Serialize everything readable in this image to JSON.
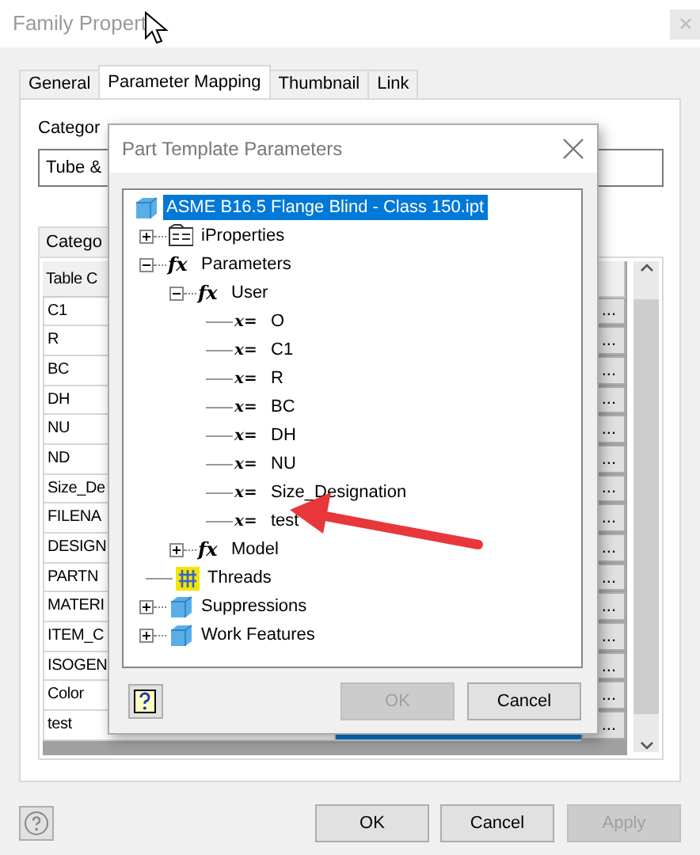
{
  "window": {
    "title": "Family Propert",
    "close_enabled": false
  },
  "tabs": [
    {
      "label": "General",
      "selected": false
    },
    {
      "label": "Parameter Mapping",
      "selected": true
    },
    {
      "label": "Thumbnail",
      "selected": false
    },
    {
      "label": "Link",
      "selected": false
    }
  ],
  "category": {
    "label": "Categor",
    "value": "Tube &"
  },
  "group_tab": {
    "label": "Catego"
  },
  "table": {
    "columns": [
      "Table C"
    ],
    "rows": [
      {
        "column_1": "C1",
        "action": "..."
      },
      {
        "column_1": "R",
        "action": "..."
      },
      {
        "column_1": "BC",
        "action": "..."
      },
      {
        "column_1": "DH",
        "action": "..."
      },
      {
        "column_1": "NU",
        "action": "..."
      },
      {
        "column_1": "ND",
        "action": "..."
      },
      {
        "column_1": "Size_De",
        "action": "..."
      },
      {
        "column_1": "FILENA",
        "action": "..."
      },
      {
        "column_1": "DESIGN",
        "action": "..."
      },
      {
        "column_1": "PARTN",
        "action": "..."
      },
      {
        "column_1": "MATERI",
        "action": "..."
      },
      {
        "column_1": "ITEM_C",
        "action": "..."
      },
      {
        "column_1": "ISOGEN",
        "action": "..."
      },
      {
        "column_1": "Color",
        "action": "..."
      },
      {
        "column_1": "test",
        "action": "...",
        "value_highlighted": true
      }
    ]
  },
  "buttons": [
    {
      "label": "OK",
      "disabled": false
    },
    {
      "label": "Cancel",
      "disabled": false
    },
    {
      "label": "Apply",
      "disabled": true
    }
  ],
  "dialog": {
    "title": "Part Template Parameters",
    "tree": [
      {
        "label": "ASME B16.5 Flange Blind - Class 150.ipt",
        "kind": "part",
        "selected": true,
        "children": [
          {
            "label": "iProperties",
            "kind": "properties",
            "expanded": false,
            "selected": false
          },
          {
            "label": "Parameters",
            "kind": "group",
            "icon_text": "fx",
            "expanded": true,
            "selected": false,
            "children": [
              {
                "label": "User",
                "kind": "group",
                "icon_text": "fx",
                "expanded": true,
                "selected": false,
                "children": [
                  {
                    "label": "O",
                    "kind": "param",
                    "icon_text": "x=",
                    "selected": false
                  },
                  {
                    "label": "C1",
                    "kind": "param",
                    "icon_text": "x=",
                    "selected": false
                  },
                  {
                    "label": "R",
                    "kind": "param",
                    "icon_text": "x=",
                    "selected": false
                  },
                  {
                    "label": "BC",
                    "kind": "param",
                    "icon_text": "x=",
                    "selected": false
                  },
                  {
                    "label": "DH",
                    "kind": "param",
                    "icon_text": "x=",
                    "selected": false
                  },
                  {
                    "label": "NU",
                    "kind": "param",
                    "icon_text": "x=",
                    "selected": false
                  },
                  {
                    "label": "Size_Designation",
                    "kind": "param",
                    "icon_text": "x=",
                    "selected": false
                  },
                  {
                    "label": "test",
                    "kind": "param",
                    "icon_text": "x=",
                    "selected": false
                  }
                ]
              },
              {
                "label": "Model",
                "kind": "group",
                "icon_text": "fx",
                "expanded": false,
                "selected": false
              }
            ]
          },
          {
            "label": "Threads",
            "kind": "threads",
            "selected": false
          },
          {
            "label": "Suppressions",
            "kind": "feature",
            "expanded": false,
            "selected": false
          },
          {
            "label": "Work Features",
            "kind": "feature",
            "expanded": false,
            "selected": false
          }
        ]
      }
    ],
    "buttons": [
      {
        "label": "OK",
        "disabled": true
      },
      {
        "label": "Cancel",
        "disabled": false
      }
    ]
  }
}
